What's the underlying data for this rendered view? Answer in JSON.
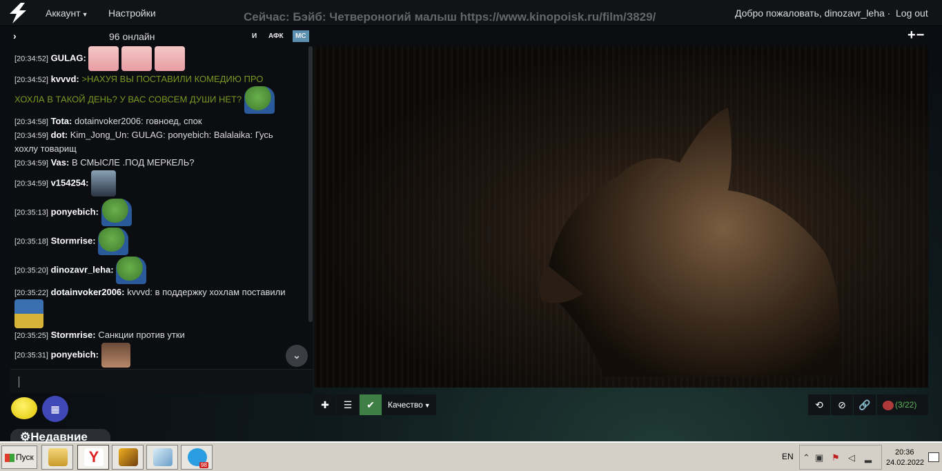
{
  "navbar": {
    "account_label": "Аккаунт",
    "settings_label": "Настройки",
    "now_playing": "Сейчас: Бэйб: Четвероногий малыш https://www.kinopoisk.ru/film/3829/",
    "welcome": "Добро пожаловать, dinozavr_leha ·",
    "logout_label": "Log out"
  },
  "chat": {
    "online": "96 онлайн",
    "btn_i": "И",
    "btn_afk": "АФК",
    "btn_mc": "МС",
    "messages": [
      {
        "time": "[20:34:52]",
        "user": "GULAG:",
        "text": ""
      },
      {
        "time": "[20:34:52]",
        "user": "kvvvd:",
        "text": ">НАХУЯ ВЫ ПОСТАВИЛИ КОМЕДИЮ ПРО",
        "text2": "ХОХЛА В ТАКОЙ ДЕНЬ? У ВАС СОВСЕМ ДУШИ НЕТ?"
      },
      {
        "time": "[20:34:58]",
        "user": "Tota:",
        "text": "dotainvoker2006: говноед, спок"
      },
      {
        "time": "[20:34:59]",
        "user": "dot:",
        "text": "Kim_Jong_Un: GULAG: ponyebich: Balalaika: Гусь",
        "text2": "хохлу товарищ"
      },
      {
        "time": "[20:34:59]",
        "user": "Vas:",
        "text": "В СМЫСЛЕ .ПОД МЕРКЕЛЬ?"
      },
      {
        "time": "[20:34:59]",
        "user": "v154254:",
        "text": ""
      },
      {
        "time": "[20:35:13]",
        "user": "ponyebich:",
        "text": ""
      },
      {
        "time": "[20:35:18]",
        "user": "Stormrise:",
        "text": ""
      },
      {
        "time": "[20:35:20]",
        "user": "dinozavr_leha:",
        "text": ""
      },
      {
        "time": "[20:35:22]",
        "user": "dotainvoker2006:",
        "text": "kvvvd: в поддержку хохлам поставили"
      },
      {
        "time": "[20:35:25]",
        "user": "Stormrise:",
        "text": "Санкции против утки"
      },
      {
        "time": "[20:35:31]",
        "user": "ponyebich:",
        "text": ""
      }
    ],
    "recent_label": "Недавние"
  },
  "player": {
    "zoom_label": "+−",
    "quality_label": "Качество",
    "vote_count": "(3/22)"
  },
  "taskbar": {
    "start_label": "Пуск",
    "telegram_badge": "98",
    "lang": "EN",
    "time": "20:36",
    "date": "24.02.2022"
  }
}
